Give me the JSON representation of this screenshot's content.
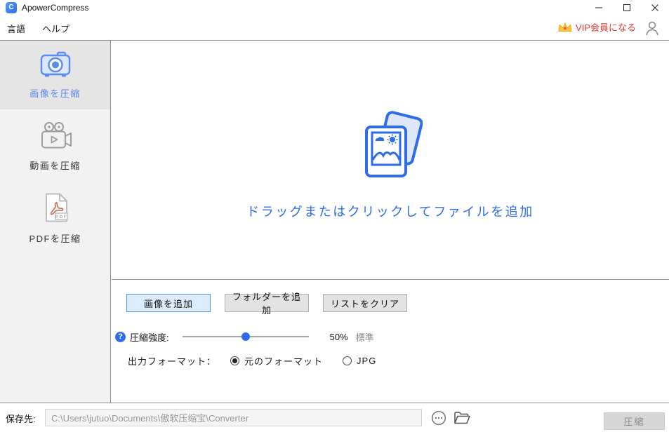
{
  "titlebar": {
    "app_title": "ApowerCompress"
  },
  "menubar": {
    "language_label": "言語",
    "help_label": "ヘルプ",
    "vip_label": "VIP会員になる"
  },
  "sidebar": {
    "items": [
      {
        "label": "画像を圧縮",
        "icon": "camera-icon",
        "active": true
      },
      {
        "label": "動画を圧縮",
        "icon": "video-camera-icon",
        "active": false
      },
      {
        "label": "PDFを圧縮",
        "icon": "pdf-file-icon",
        "active": false
      }
    ]
  },
  "dropzone": {
    "hint": "ドラッグまたはクリックしてファイルを追加"
  },
  "toolbar": {
    "add_images_label": "画像を追加",
    "add_folder_label": "フォルダーを追加",
    "clear_list_label": "リストをクリア"
  },
  "strength": {
    "label": "圧縮強度:",
    "percent": 50,
    "percent_label": "50%",
    "level_label": "標準"
  },
  "format": {
    "label": "出力フォーマット：",
    "options": [
      {
        "label": "元のフォーマット",
        "selected": true
      },
      {
        "label": "JPG",
        "selected": false
      }
    ]
  },
  "footer": {
    "save_label": "保存先:",
    "path": "C:\\Users\\jutuo\\Documents\\傲软压缩宝\\Converter",
    "compress_label": "圧縮"
  },
  "colors": {
    "accent_blue": "#2f6ceb",
    "sidebar_active_text": "#5b87ee",
    "vip_red": "#e6382e",
    "crown_gold": "#fcc43e",
    "separator_gray": "#8f8f8f",
    "add_images_button_border": "#4a9ce8",
    "add_images_button_bg": "#ddecfb"
  }
}
